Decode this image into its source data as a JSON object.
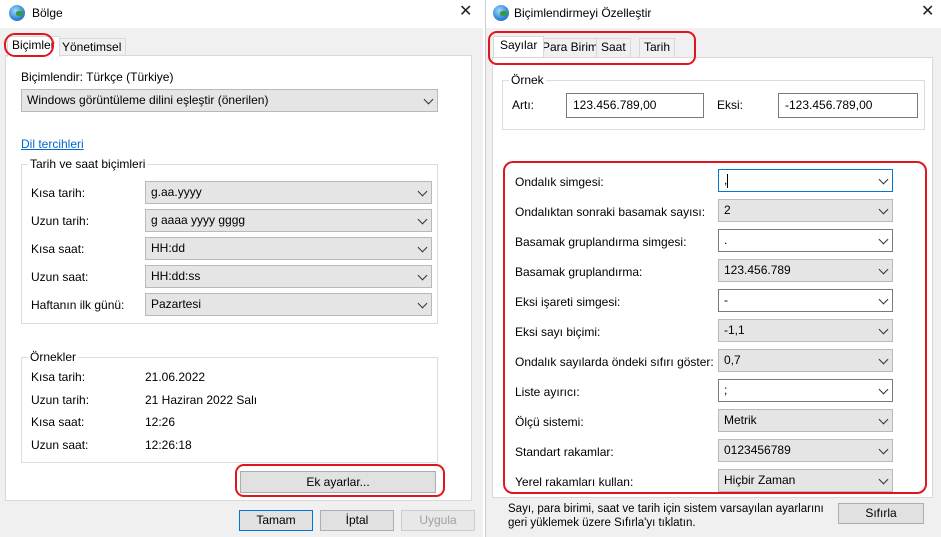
{
  "left_window": {
    "title": "Bölge",
    "tabs": [
      "Biçimler",
      "Yönetimsel"
    ],
    "format_label": "Biçimlendir: Türkçe (Türkiye)",
    "format_value": "Windows görüntüleme dilini eşleştir (önerilen)",
    "language_link": "Dil tercihleri",
    "datetime_group_title": "Tarih ve saat biçimleri",
    "datetime_rows": [
      {
        "label": "Kısa tarih:",
        "value": "g.aa.yyyy"
      },
      {
        "label": "Uzun tarih:",
        "value": "g aaaa yyyy gggg"
      },
      {
        "label": "Kısa saat:",
        "value": "HH:dd"
      },
      {
        "label": "Uzun saat:",
        "value": "HH:dd:ss"
      },
      {
        "label": "Haftanın ilk günü:",
        "value": "Pazartesi"
      }
    ],
    "examples_title": "Örnekler",
    "examples": [
      {
        "label": "Kısa tarih:",
        "value": "21.06.2022"
      },
      {
        "label": "Uzun tarih:",
        "value": "21 Haziran 2022 Salı"
      },
      {
        "label": "Kısa saat:",
        "value": "12:26"
      },
      {
        "label": "Uzun saat:",
        "value": "12:26:18"
      }
    ],
    "additional_settings": "Ek ayarlar...",
    "ok": "Tamam",
    "cancel": "İptal",
    "apply": "Uygula"
  },
  "right_window": {
    "title": "Biçimlendirmeyi Özelleştir",
    "tabs": [
      "Sayılar",
      "Para Birimi",
      "Saat",
      "Tarih"
    ],
    "example_title": "Örnek",
    "positive_label": "Artı:",
    "positive_value": "123.456.789,00",
    "negative_label": "Eksi:",
    "negative_value": "-123.456.789,00",
    "settings": [
      {
        "label": "Ondalık simgesi:",
        "value": ","
      },
      {
        "label": "Ondalıktan sonraki basamak sayısı:",
        "value": "2"
      },
      {
        "label": "Basamak gruplandırma simgesi:",
        "value": "."
      },
      {
        "label": "Basamak gruplandırma:",
        "value": "123.456.789"
      },
      {
        "label": "Eksi işareti simgesi:",
        "value": "-"
      },
      {
        "label": "Eksi sayı biçimi:",
        "value": "-1,1"
      },
      {
        "label": "Ondalık sayılarda öndeki sıfırı göster:",
        "value": "0,7"
      },
      {
        "label": "Liste ayırıcı:",
        "value": ";"
      },
      {
        "label": "Ölçü sistemi:",
        "value": "Metrik"
      },
      {
        "label": "Standart rakamlar:",
        "value": "0123456789"
      },
      {
        "label": "Yerel rakamları kullan:",
        "value": "Hiçbir Zaman"
      }
    ],
    "reset_text_1": "Sayı, para birimi, saat ve tarih için sistem varsayılan ayarlarını",
    "reset_text_2": "geri yüklemek üzere Sıfırla'yı tıklatın.",
    "reset_button": "Sıfırla"
  },
  "colors": {
    "highlight": "#e0151e",
    "link": "#0066cc",
    "focus": "#0078d7"
  }
}
